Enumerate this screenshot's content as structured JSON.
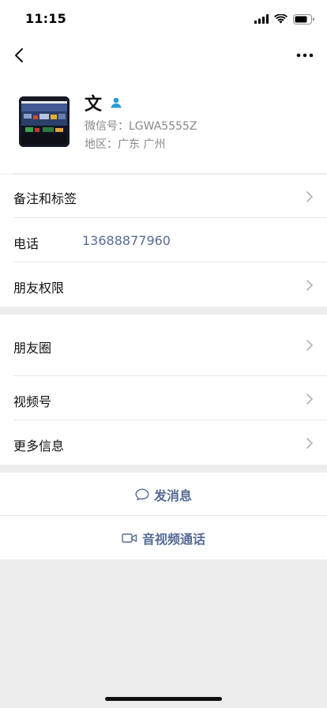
{
  "status_bar": {
    "time": "11:15",
    "icons": [
      "cellular-signal-icon",
      "wifi-icon",
      "battery-icon"
    ]
  },
  "nav": {
    "back_icon": "chevron-left-icon",
    "more_icon": "more-dots-icon"
  },
  "profile": {
    "name": "文",
    "badge_icon": "person-badge-icon",
    "wechat_id": "微信号：LGWA5555Z",
    "region": "地区：广东 广州"
  },
  "rows": {
    "remark_tags": "备注和标签",
    "phone_label": "电话",
    "phone_value": "13688877960",
    "friend_permissions": "朋友权限",
    "moments": "朋友圈",
    "channels": "视频号",
    "more_info": "更多信息"
  },
  "actions": {
    "send_message": "发消息",
    "av_call": "音视频通话"
  },
  "colors": {
    "link": "#576b95",
    "background": "#ededed",
    "accent_badge": "#2a9bd8"
  }
}
